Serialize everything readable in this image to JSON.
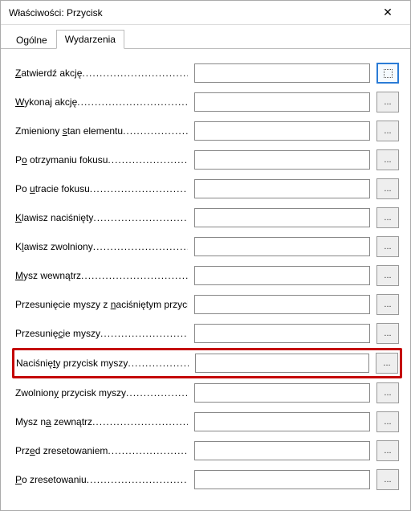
{
  "window": {
    "title": "Właściwości: Przycisk",
    "close": "✕"
  },
  "tabs": {
    "general": "Ogólne",
    "events": "Wydarzenia"
  },
  "events": [
    {
      "pre": "",
      "u": "Z",
      "post": "atwierdź akcję",
      "value": "",
      "highlight": false,
      "focused": true
    },
    {
      "pre": "",
      "u": "W",
      "post": "ykonaj akcję",
      "value": "",
      "highlight": false,
      "focused": false
    },
    {
      "pre": "Zmieniony ",
      "u": "s",
      "post": "tan elementu",
      "value": "",
      "highlight": false,
      "focused": false
    },
    {
      "pre": "P",
      "u": "o",
      "post": " otrzymaniu fokusu",
      "value": "",
      "highlight": false,
      "focused": false
    },
    {
      "pre": "Po ",
      "u": "u",
      "post": "tracie fokusu",
      "value": "",
      "highlight": false,
      "focused": false
    },
    {
      "pre": "",
      "u": "K",
      "post": "lawisz naciśnięty",
      "value": "",
      "highlight": false,
      "focused": false
    },
    {
      "pre": "K",
      "u": "l",
      "post": "awisz zwolniony",
      "value": "",
      "highlight": false,
      "focused": false
    },
    {
      "pre": "",
      "u": "M",
      "post": "ysz wewnątrz",
      "value": "",
      "highlight": false,
      "focused": false
    },
    {
      "pre": "Przesunięcie myszy z ",
      "u": "n",
      "post": "aciśniętym przyciskiem",
      "value": "",
      "highlight": false,
      "focused": false
    },
    {
      "pre": "Przesunię",
      "u": "c",
      "post": "ie myszy",
      "value": "",
      "highlight": false,
      "focused": false
    },
    {
      "pre": "Naciśnię",
      "u": "t",
      "post": "y przycisk myszy",
      "value": "",
      "highlight": true,
      "focused": false
    },
    {
      "pre": "Zwolnion",
      "u": "y",
      "post": " przycisk myszy",
      "value": "",
      "highlight": false,
      "focused": false
    },
    {
      "pre": "Mysz n",
      "u": "a",
      "post": " zewnątrz",
      "value": "",
      "highlight": false,
      "focused": false
    },
    {
      "pre": "Prz",
      "u": "e",
      "post": "d zresetowaniem",
      "value": "",
      "highlight": false,
      "focused": false
    },
    {
      "pre": "",
      "u": "P",
      "post": "o zresetowaniu",
      "value": "",
      "highlight": false,
      "focused": false
    }
  ],
  "btnLabel": "...",
  "dots": "........................................................................"
}
